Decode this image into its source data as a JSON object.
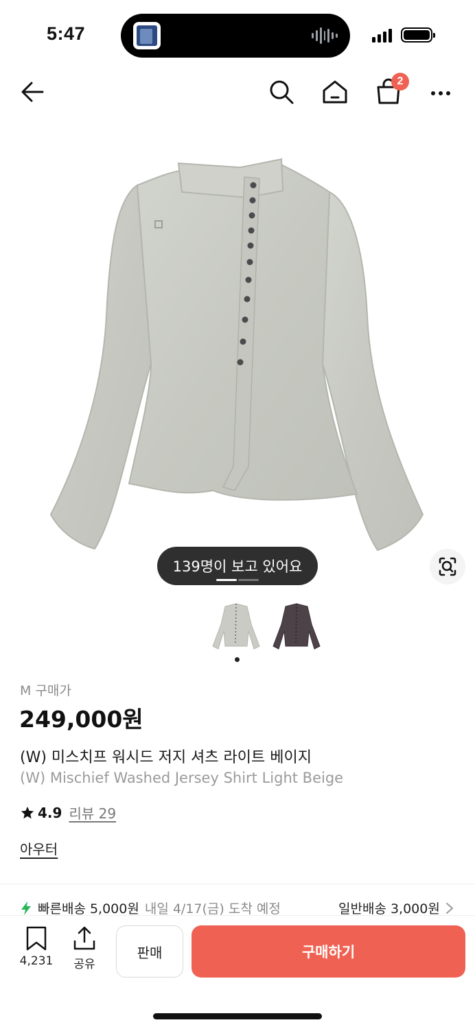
{
  "status_bar": {
    "time": "5:47"
  },
  "nav": {
    "cart_count": "2"
  },
  "viewers": {
    "text": "139명이 보고 있어요"
  },
  "product": {
    "size_label": "M 구매가",
    "price": "249,000원",
    "name_ko": "(W) 미스치프 워시드 저지 셔츠 라이트 베이지",
    "name_en": "(W) Mischief Washed Jersey Shirt Light Beige",
    "rating": "4.9",
    "review_text": "리뷰 29",
    "category": "아우터"
  },
  "shipping": {
    "fast_label": "빠른배송 5,000원",
    "fast_eta": "내일 4/17(금) 도착 예정",
    "normal_label": "일반배송 3,000원"
  },
  "bottom_bar": {
    "bookmark_count": "4,231",
    "share_label": "공유",
    "sell_label": "판매",
    "buy_label": "구매하기"
  },
  "colors": {
    "accent": "#ef6253",
    "fast_ship_green": "#2ab55b",
    "shirt_light": "#c9cbc4",
    "shirt_dark": "#4d4248"
  },
  "icons": [
    "back-arrow-icon",
    "search-icon",
    "home-icon",
    "cart-icon",
    "more-icon",
    "lens-icon",
    "star-icon",
    "bolt-icon",
    "chevron-right-icon",
    "bookmark-icon",
    "share-icon"
  ]
}
